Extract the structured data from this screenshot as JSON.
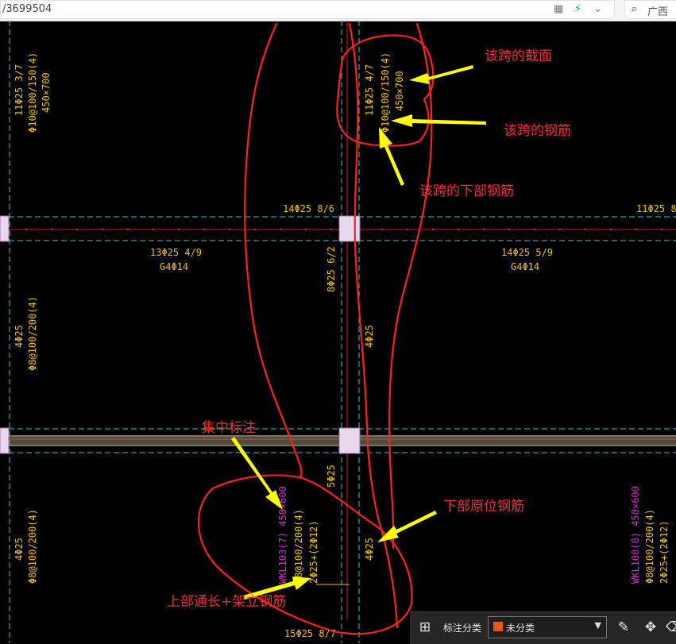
{
  "browser": {
    "url_text": "/3699504",
    "search_text": "广西",
    "icons": [
      "grid-icon",
      "bolt-icon",
      "chevron-down-icon",
      "search-icon"
    ]
  },
  "drawing": {
    "labels": {
      "l1": "11Φ25 3/7",
      "l2": "Φ10@100/150(4)",
      "l3": "450×700",
      "l4": "11Φ25 4/7",
      "l5": "Φ10@100/150(4)",
      "l6": "450×700",
      "l7": "14Φ25 8/6",
      "l8": "11Φ25 8/",
      "l9": "13Φ25 4/9",
      "l10": "G4Φ14",
      "l11": "14Φ25 5/9",
      "l12": "G4Φ14",
      "l13": "8Φ25 6/2",
      "l14": "4Φ25",
      "l15": "Φ8@100/200(4)",
      "l16": "4Φ25",
      "l17": "5Φ25",
      "l18": "WKL103(7) 450×600",
      "l19": "Φ8@100/200(4)",
      "l20": "2Φ25+(2Φ12)",
      "l21": "4Φ25",
      "l22": "4Φ25",
      "l23": "Φ8@100/200(4)",
      "l24": "WKL108(8) 450×600",
      "l25": "Φ8@100/200(4)",
      "l26": "2Φ25+(2Φ12)",
      "l27": "15Φ25 8/7"
    },
    "annotations": {
      "section": "该跨的截面",
      "rebar": "该跨的钢筋",
      "bottom_rebar": "该跨的下部钢筋",
      "centralized": "集中标注",
      "bottom_in_situ": "下部原位钢筋",
      "top_through": "上部通长+架立钢筋"
    }
  },
  "toolbar": {
    "label": "标注分类",
    "select_value": "未分类",
    "swatch_color": "#e55a12",
    "icons": [
      "category-grid-icon",
      "edit-icon",
      "move-icon",
      "delete-icon"
    ]
  }
}
